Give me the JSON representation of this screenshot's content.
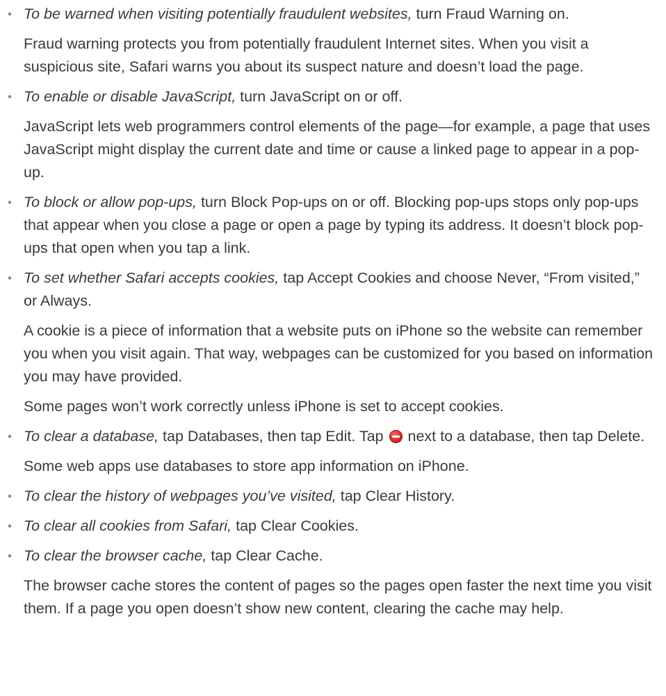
{
  "bullet_symbol": "•",
  "items": [
    {
      "lead": "To be warned when visiting potentially fraudulent websites,",
      "text": " turn Fraud Warning on.",
      "notes": [
        "Fraud warning protects you from potentially fraudulent Internet sites. When you visit a suspicious site, Safari warns you about its suspect nature and doesn’t load the page."
      ]
    },
    {
      "lead": "To enable or disable JavaScript,",
      "text": " turn JavaScript on or off.",
      "notes": [
        "JavaScript lets web programmers control elements of the page—for example, a page that uses JavaScript might display the current date and time or cause a linked page to appear in a pop-up."
      ]
    },
    {
      "lead": "To block or allow pop-ups,",
      "text": " turn Block Pop-ups on or off. Blocking pop-ups stops only pop-ups that appear when you close a page or open a page by typing its address. It doesn’t block pop-ups that open when you tap a link."
    },
    {
      "lead": "To set whether Safari accepts cookies,",
      "text": " tap Accept Cookies and choose Never, “From visited,” or Always.",
      "notes": [
        "A cookie is a piece of information that a website puts on iPhone so the website can remember you when you visit again. That way, webpages can be customized for you based on information you may have provided.",
        "Some pages won’t work correctly unless iPhone is set to accept cookies."
      ]
    },
    {
      "lead": "To clear a database,",
      "text_before_icon": " tap Databases, then tap Edit. Tap ",
      "icon": "delete-icon",
      "text_after_icon": " next to a database, then tap Delete.",
      "notes": [
        "Some web apps use databases to store app information on iPhone."
      ]
    },
    {
      "lead": "To clear the history of webpages you’ve visited,",
      "text": " tap Clear History."
    },
    {
      "lead": "To clear all cookies from Safari,",
      "text": " tap Clear Cookies."
    },
    {
      "lead": "To clear the browser cache,",
      "text": " tap Clear Cache.",
      "notes": [
        "The browser cache stores the content of pages so the pages open faster the next time you visit them. If a page you open doesn’t show new content, clearing the cache may help."
      ]
    }
  ]
}
